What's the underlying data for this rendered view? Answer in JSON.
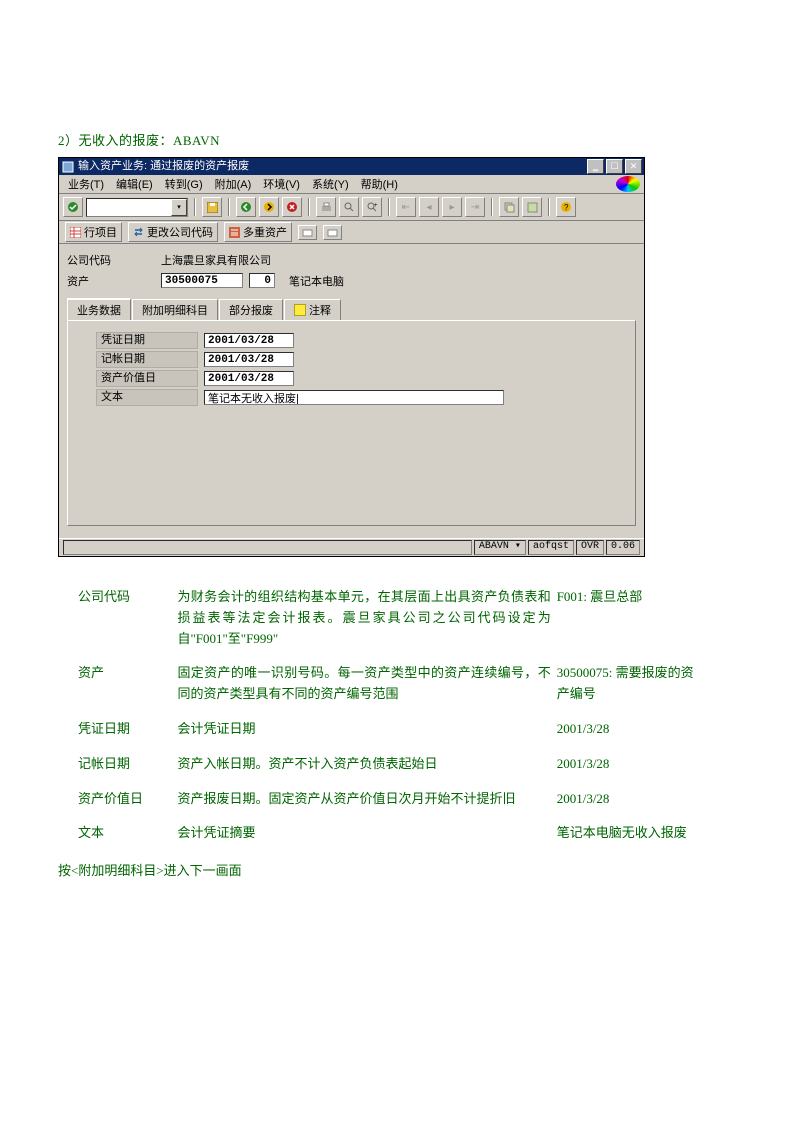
{
  "heading": "2）无收入的报废：ABAVN",
  "window": {
    "title": "输入资产业务: 通过报废的资产报废",
    "menu": [
      "业务(T)",
      "编辑(E)",
      "转到(G)",
      "附加(A)",
      "环境(V)",
      "系统(Y)",
      "帮助(H)"
    ]
  },
  "apptoolbar": {
    "b1": "行项目",
    "b2": "更改公司代码",
    "b3": "多重资产"
  },
  "header": {
    "company_label": "公司代码",
    "company_value": "上海震旦家具有限公司",
    "asset_label": "资产",
    "asset_no": "30500075",
    "asset_sub": "0",
    "asset_desc": "笔记本电脑"
  },
  "tabs": {
    "t1": "业务数据",
    "t2": "附加明细科目",
    "t3": "部分报废",
    "t4": "注释"
  },
  "panel": {
    "r1": {
      "label": "凭证日期",
      "value": "2001/03/28"
    },
    "r2": {
      "label": "记帐日期",
      "value": "2001/03/28"
    },
    "r3": {
      "label": "资产价值日",
      "value": "2001/03/28"
    },
    "r4": {
      "label": "文本",
      "value": "笔记本无收入报废|"
    }
  },
  "status": {
    "a": "ABAVN ▾",
    "b": "aofqst",
    "c": "OVR",
    "d": "0.06"
  },
  "expl": [
    {
      "k": "公司代码",
      "d": "为财务会计的组织结构基本单元，在其层面上出具资产负债表和损益表等法定会计报表。震旦家具公司之公司代码设定为自\"F001\"至\"F999\"",
      "v": "F001: 震旦总部"
    },
    {
      "k": "资产",
      "d": "固定资产的唯一识别号码。每一资产类型中的资产连续编号，不同的资产类型具有不同的资产编号范围",
      "v": "30500075: 需要报废的资产编号"
    },
    {
      "k": "凭证日期",
      "d": "会计凭证日期",
      "v": "2001/3/28"
    },
    {
      "k": "记帐日期",
      "d": "资产入帐日期。资产不计入资产负债表起始日",
      "v": "2001/3/28"
    },
    {
      "k": "资产价值日",
      "d": "资产报废日期。固定资产从资产价值日次月开始不计提折旧",
      "v": "2001/3/28"
    },
    {
      "k": "文本",
      "d": "会计凭证摘要",
      "v": "笔记本电脑无收入报废"
    }
  ],
  "footer": "按<附加明细科目>进入下一画面"
}
